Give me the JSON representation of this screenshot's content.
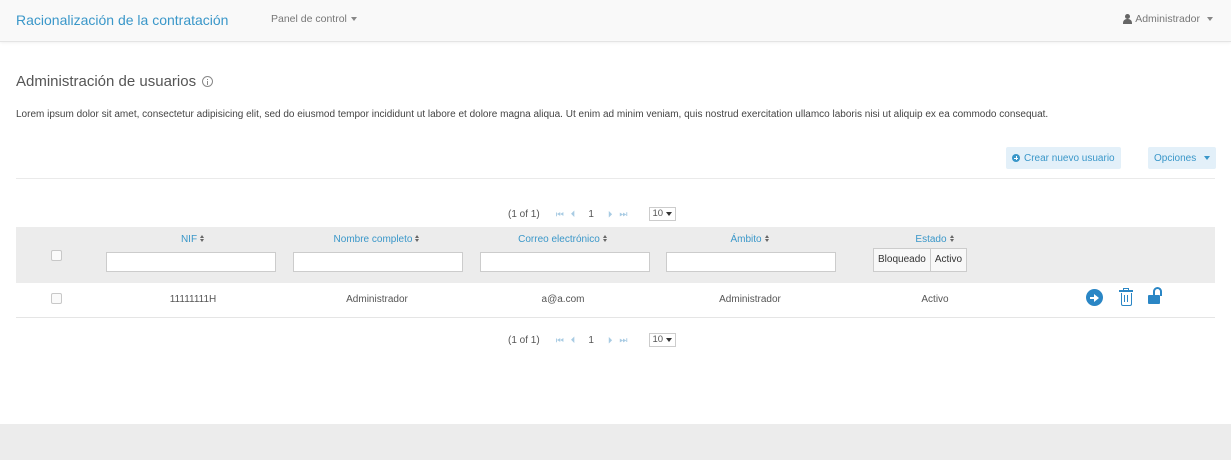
{
  "navbar": {
    "brand": "Racionalización de la contratación",
    "panel_menu": "Panel de control",
    "user_menu": "Administrador",
    "user_icon": "user-icon"
  },
  "page": {
    "title": "Administración de usuarios",
    "description": "Lorem ipsum dolor sit amet, consectetur adipisicing elit, sed do eiusmod tempor incididunt ut labore et dolore magna aliqua. Ut enim ad minim veniam, quis nostrud exercitation ullamco laboris nisi ut aliquip ex ea commodo consequat."
  },
  "actions": {
    "create_user": "Crear nuevo usuario",
    "options": "Opciones"
  },
  "paginator": {
    "info": "(1 of 1)",
    "first": "⏮",
    "prev": "⏴",
    "page": "1",
    "next": "⏵",
    "last": "⏭",
    "rows_per_page": "10"
  },
  "table": {
    "columns": {
      "nif": "NIF",
      "nombre": "Nombre completo",
      "correo": "Correo electrónico",
      "ambito": "Ámbito",
      "estado": "Estado"
    },
    "estado_filter": [
      "Bloqueado",
      "Activo"
    ],
    "rows": [
      {
        "nif": "11111111H",
        "nombre": "Administrador",
        "correo": "a@a.com",
        "ambito": "Administrador",
        "estado": "Activo"
      }
    ],
    "row_actions": [
      "arrow-circle-right-icon",
      "trash-icon",
      "unlock-icon"
    ]
  },
  "colors": {
    "accent": "#3a97c9",
    "action_icons": "#2a86c5",
    "header_bg": "#ececec"
  }
}
